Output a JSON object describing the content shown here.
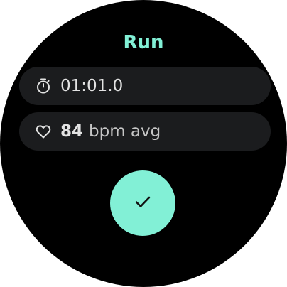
{
  "colors": {
    "accent": "#82f0d6",
    "chip_background": "#1b1c1e",
    "text_primary": "#e3e3e3",
    "screen_background": "#000000"
  },
  "screen": {
    "title": "Run"
  },
  "stats": {
    "duration": {
      "icon": "timer-icon",
      "value": "01:01.0"
    },
    "heart_rate": {
      "icon": "heart-icon",
      "value": "84",
      "unit": "bpm avg"
    }
  },
  "actions": {
    "confirm_icon": "checkmark-icon"
  }
}
